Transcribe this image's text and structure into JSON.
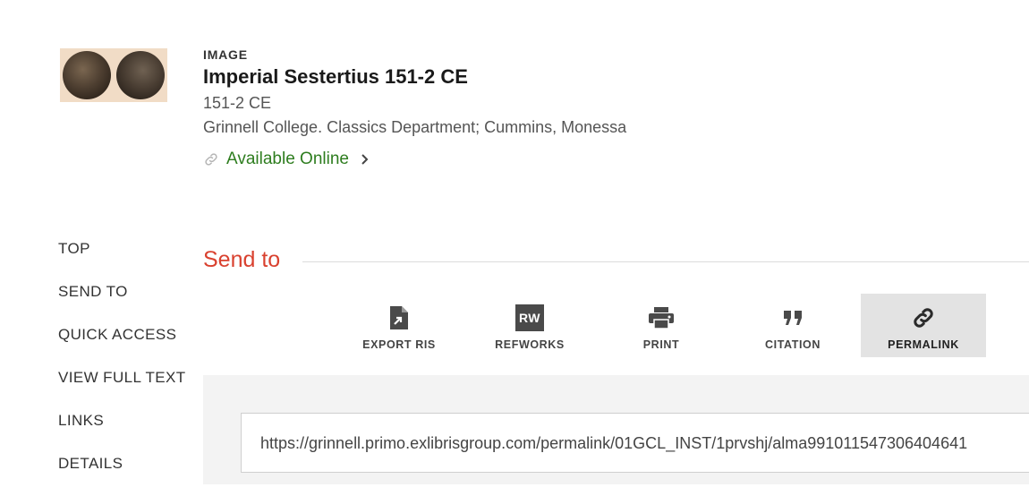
{
  "record": {
    "type": "IMAGE",
    "title": "Imperial Sestertius 151-2 CE",
    "date": "151-2 CE",
    "creator": "Grinnell College. Classics Department; Cummins, Monessa",
    "availability": "Available Online"
  },
  "nav": [
    "TOP",
    "SEND TO",
    "QUICK ACCESS",
    "VIEW FULL TEXT",
    "LINKS",
    "DETAILS"
  ],
  "send_to": {
    "heading": "Send to",
    "tools": [
      {
        "label": "EXPORT RIS",
        "icon": "export-ris-icon"
      },
      {
        "label": "REFWORKS",
        "icon": "refworks-icon",
        "badge": "RW"
      },
      {
        "label": "PRINT",
        "icon": "print-icon"
      },
      {
        "label": "CITATION",
        "icon": "quote-icon"
      },
      {
        "label": "PERMALINK",
        "icon": "link-icon",
        "active": true
      }
    ],
    "permalink": "https://grinnell.primo.exlibrisgroup.com/permalink/01GCL_INST/1prvshj/alma991011547306404641"
  },
  "colors": {
    "accent": "#d9412f",
    "available": "#2e7d1f",
    "active_tool_bg": "#e3e3e3",
    "panel_bg": "#f3f3f3"
  }
}
